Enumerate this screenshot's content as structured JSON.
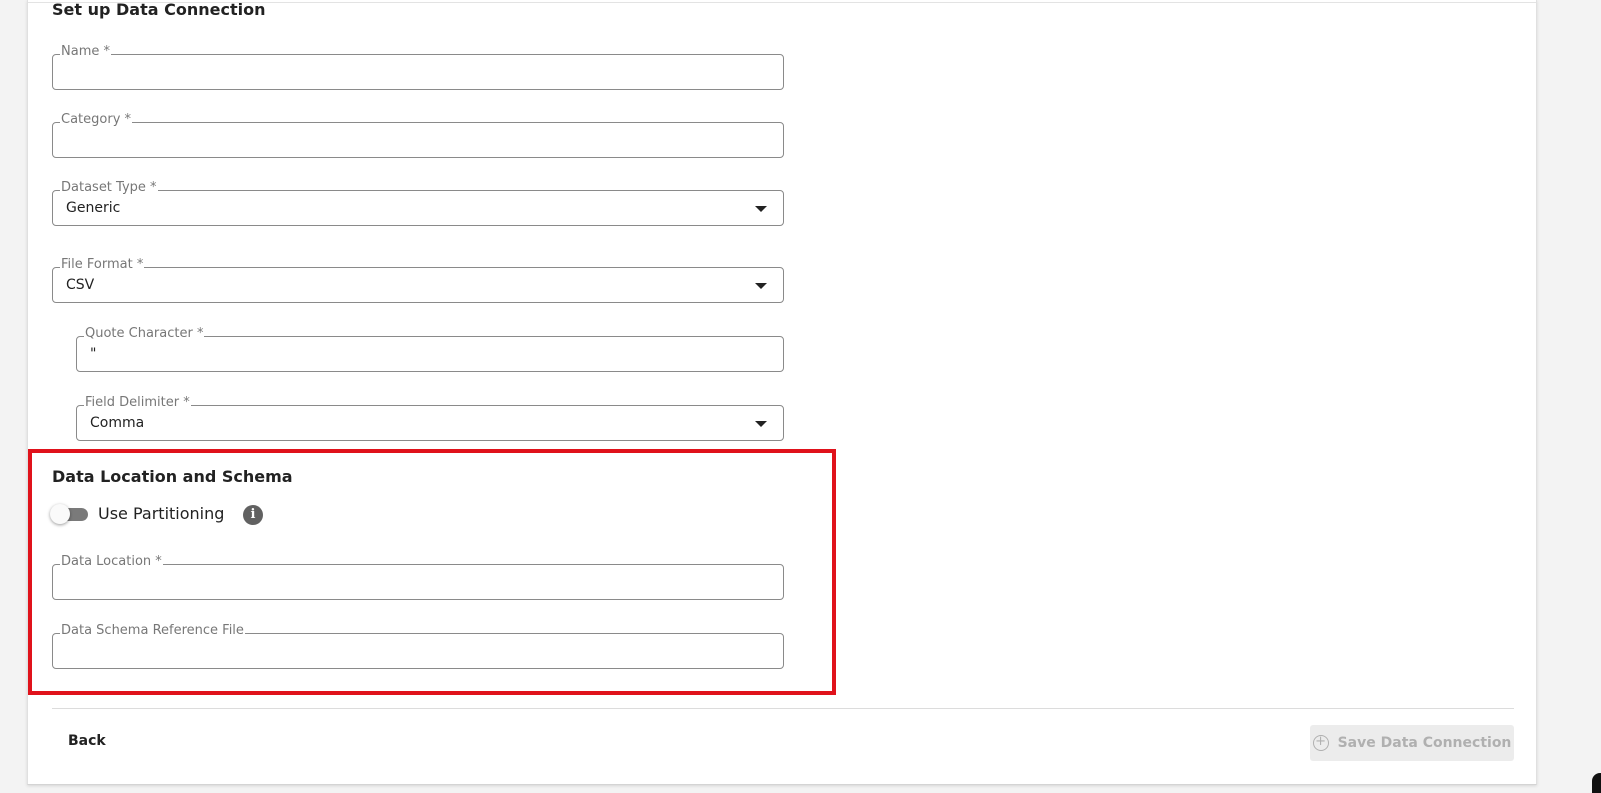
{
  "form": {
    "title": "Set up Data Connection",
    "name": {
      "label": "Name *",
      "value": ""
    },
    "category": {
      "label": "Category *",
      "value": ""
    },
    "dataset_type": {
      "label": "Dataset Type *",
      "value": "Generic"
    },
    "file_format": {
      "label": "File Format *",
      "value": "CSV"
    },
    "quote_character": {
      "label": "Quote Character *",
      "value": "\""
    },
    "field_delimiter": {
      "label": "Field Delimiter *",
      "value": "Comma"
    }
  },
  "location": {
    "title": "Data Location and Schema",
    "use_partitioning": {
      "label": "Use Partitioning",
      "enabled": false
    },
    "data_location": {
      "label": "Data Location *",
      "value": ""
    },
    "schema_file": {
      "label": "Data Schema Reference File",
      "value": ""
    }
  },
  "footer": {
    "back_label": "Back",
    "save_label": "Save Data Connection"
  },
  "colors": {
    "highlight": "#e0121b",
    "field_border": "#8a8a8a",
    "disabled_text": "#b0b0b0"
  },
  "icons": {
    "dropdown": "caret-down-icon",
    "info": "info-icon",
    "save": "plus-circle-icon"
  }
}
